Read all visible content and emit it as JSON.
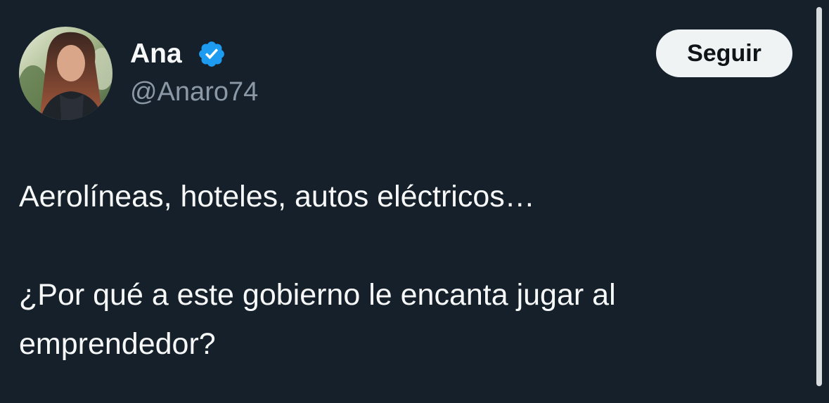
{
  "user": {
    "display_name": "Ana",
    "handle": "@Anaro74",
    "verified": true,
    "avatar_icon": "profile-photo"
  },
  "actions": {
    "follow_label": "Seguir"
  },
  "tweet": {
    "lines": [
      "Aerolíneas, hoteles, autos eléctricos…",
      "¿Por qué a este gobierno le encanta jugar al",
      "emprendedor?"
    ]
  },
  "colors": {
    "background": "#15202b",
    "text_primary": "#f7f9f9",
    "text_secondary": "#8b98a5",
    "verified_badge": "#1d9bf0",
    "follow_button_bg": "#eff3f4",
    "follow_button_text": "#0f1419"
  }
}
